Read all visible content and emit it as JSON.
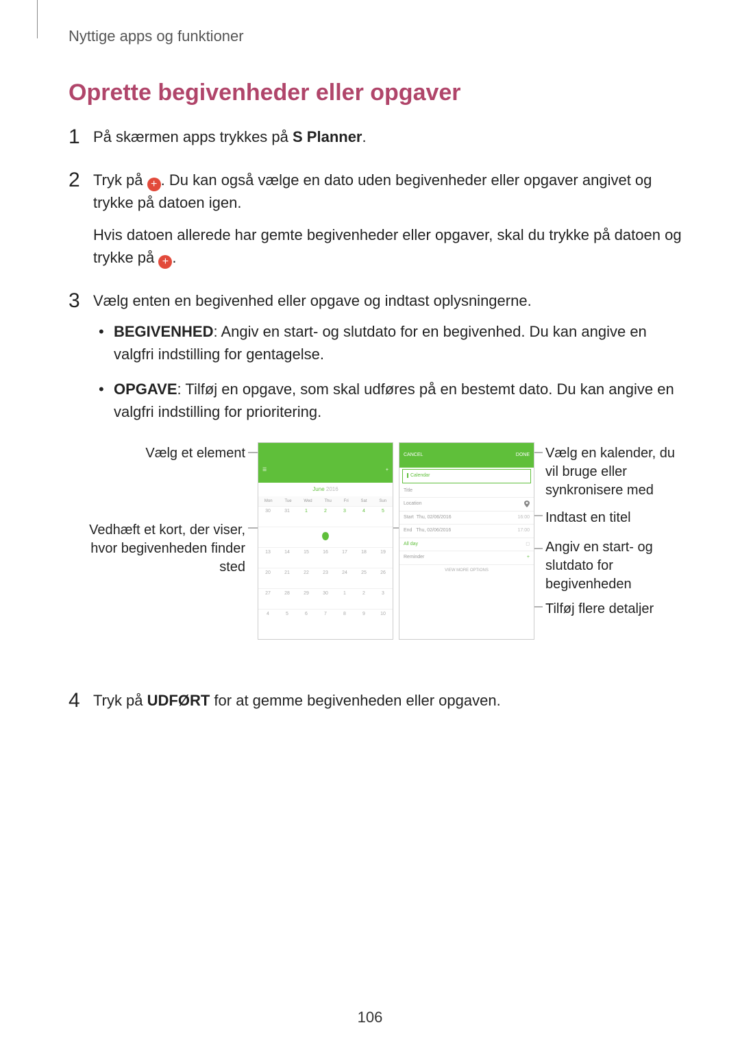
{
  "breadcrumb": "Nyttige apps og funktioner",
  "section_title": "Oprette begivenheder eller opgaver",
  "steps": {
    "s1_a": "På skærmen apps trykkes på ",
    "s1_b": "S Planner",
    "s1_c": ".",
    "s2_a": "Tryk på ",
    "s2_b": ". Du kan også vælge en dato uden begivenheder eller opgaver angivet og trykke på datoen igen.",
    "s2_sub_a": "Hvis datoen allerede har gemte begivenheder eller opgaver, skal du trykke på datoen og trykke på ",
    "s2_sub_b": ".",
    "s3": "Vælg enten en begivenhed eller opgave og indtast oplysningerne.",
    "s3_b1_a": "BEGIVENHED",
    "s3_b1_b": ": Angiv en start- og slutdato for en begivenhed. Du kan angive en valgfri indstilling for gentagelse.",
    "s3_b2_a": "OPGAVE",
    "s3_b2_b": ": Tilføj en opgave, som skal udføres på en bestemt dato. Du kan angive en valgfri indstilling for prioritering.",
    "s4_a": "Tryk på ",
    "s4_b": "UDFØRT",
    "s4_c": " for at gemme begivenheden eller opgaven."
  },
  "callouts": {
    "left1": "Vælg et element",
    "left2": "Vedhæft et kort, der viser, hvor begivenheden finder sted",
    "right1": "Vælg en kalender, du vil bruge eller synkronisere med",
    "right2": "Indtast en titel",
    "right3": "Angiv en start- og slutdato for begivenheden",
    "right4": "Tilføj flere detaljer"
  },
  "mock_left": {
    "month": "June",
    "year": "2016",
    "dow": [
      "Mon",
      "Tue",
      "Wed",
      "Thu",
      "Fri",
      "Sat",
      "Sun"
    ],
    "r1": [
      "30",
      "31",
      "1",
      "2",
      "3",
      "4",
      "5"
    ],
    "r2": [
      "13",
      "14",
      "15",
      "16",
      "17",
      "18",
      "19"
    ],
    "r3": [
      "20",
      "21",
      "22",
      "23",
      "24",
      "25",
      "26"
    ],
    "r4": [
      "27",
      "28",
      "29",
      "30",
      "1",
      "2",
      "3"
    ],
    "r5": [
      "4",
      "5",
      "6",
      "7",
      "8",
      "9",
      "10"
    ]
  },
  "mock_right": {
    "cancel": "CANCEL",
    "done": "DONE",
    "calendar": "Calendar",
    "title": "Title",
    "location": "Location",
    "start": "Start",
    "end": "End",
    "start_val": "Thu, 02/06/2016",
    "end_val": "Thu, 02/06/2016",
    "start_t": "16:00",
    "end_t": "17:00",
    "allday": "All day",
    "reminder": "Reminder",
    "view_more": "VIEW MORE OPTIONS"
  },
  "page_number": "106"
}
